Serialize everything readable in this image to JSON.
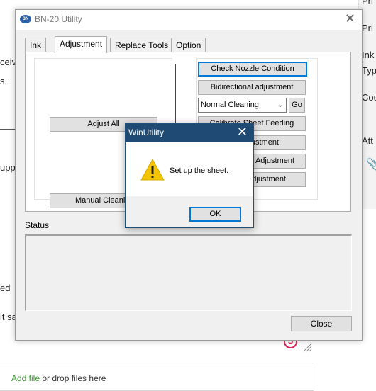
{
  "background": {
    "frag_top": "Pri",
    "frag_pri": "Pri",
    "frag_ink": "Ink",
    "frag_typ": "Typ",
    "frag_cou": "Cou",
    "frag_att": "Att",
    "frag_ceiv": "ceiv",
    "frag_s": "s.",
    "frag_uppo": "uppo",
    "frag_ed": "ed",
    "frag_sa": "it sa",
    "add_file_link": "Add file",
    "add_file_rest": " or drop files here",
    "badge_letter": "S"
  },
  "window": {
    "title": "BN-20 Utility",
    "icon_text": "BN",
    "close_glyph": "✕",
    "tabs": [
      {
        "label": "Ink"
      },
      {
        "label": "Adjustment"
      },
      {
        "label": "Replace Tools"
      },
      {
        "label": "Option"
      }
    ],
    "buttons": {
      "adjust_all": "Adjust All",
      "manual_cleaning": "Manual Cleanin",
      "check_nozzle": "Check Nozzle Condition",
      "bidirectional": "Bidirectional adjustment",
      "go": "Go",
      "calibrate_sheet": "Calibrate Sheet Feeding",
      "adjust_row4": "ustment",
      "adjust_row5": "Adjustment",
      "adjust_row6": "djustment",
      "close": "Close"
    },
    "cleaning_select": {
      "value": "Normal Cleaning"
    },
    "status_label": "Status"
  },
  "dialog": {
    "title": "WinUtility",
    "close_glyph": "✕",
    "message": "Set up the sheet.",
    "ok_label": "OK",
    "icon": "warning-icon"
  },
  "colors": {
    "dialog_title_bg": "#1e4a73",
    "focus_border": "#0078d7",
    "warning_yellow": "#f5c400",
    "link_green": "#3a9a2e"
  }
}
